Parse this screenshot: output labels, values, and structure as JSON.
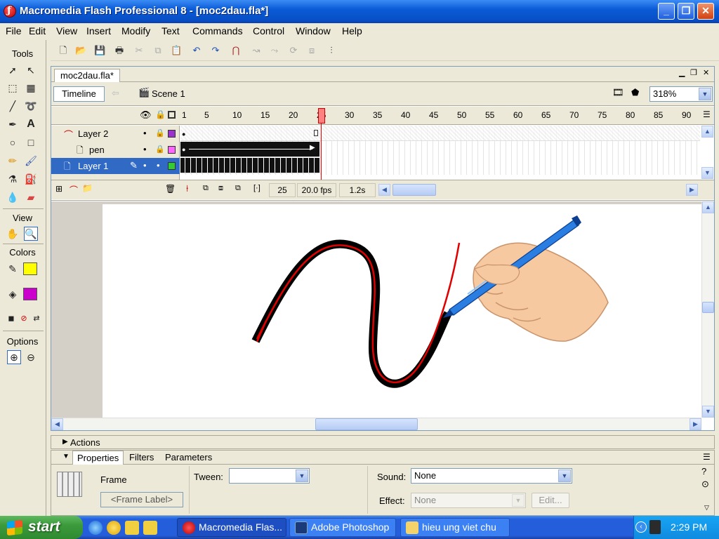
{
  "window": {
    "title": "Macromedia Flash Professional 8 - [moc2dau.fla*]"
  },
  "menu": [
    "File",
    "Edit",
    "View",
    "Insert",
    "Modify",
    "Text",
    "Commands",
    "Control",
    "Window",
    "Help"
  ],
  "tools": {
    "header": "Tools",
    "view_header": "View",
    "colors_header": "Colors",
    "options_header": "Options",
    "stroke_color": "#ffff00",
    "fill_color": "#cc00cc"
  },
  "document": {
    "tab": "moc2dau.fla*",
    "timeline_button": "Timeline",
    "scene": "Scene 1",
    "zoom": "318%"
  },
  "timeline": {
    "frame_numbers": [
      "1",
      "5",
      "10",
      "15",
      "20",
      "25",
      "30",
      "35",
      "40",
      "45",
      "50",
      "55",
      "60",
      "65",
      "70",
      "75",
      "80",
      "85",
      "90"
    ],
    "layers": [
      {
        "name": "Layer 2",
        "color": "#9933cc"
      },
      {
        "name": "pen",
        "color": "#ff66ff"
      },
      {
        "name": "Layer 1",
        "color": "#33cc33"
      }
    ],
    "current_frame": "25",
    "fps": "20.0 fps",
    "elapsed": "1.2s"
  },
  "panels": {
    "actions": "Actions",
    "tabs": [
      "Properties",
      "Filters",
      "Parameters"
    ],
    "frame_label": "Frame",
    "frame_label_placeholder": "<Frame Label>",
    "tween_label": "Tween:",
    "tween_value": "",
    "sound_label": "Sound:",
    "sound_value": "None",
    "effect_label": "Effect:",
    "effect_value": "None",
    "edit_button": "Edit..."
  },
  "taskbar": {
    "start": "start",
    "tasks": [
      "Macromedia Flas...",
      "Adobe Photoshop",
      "hieu ung viet chu"
    ],
    "clock": "2:29 PM"
  }
}
